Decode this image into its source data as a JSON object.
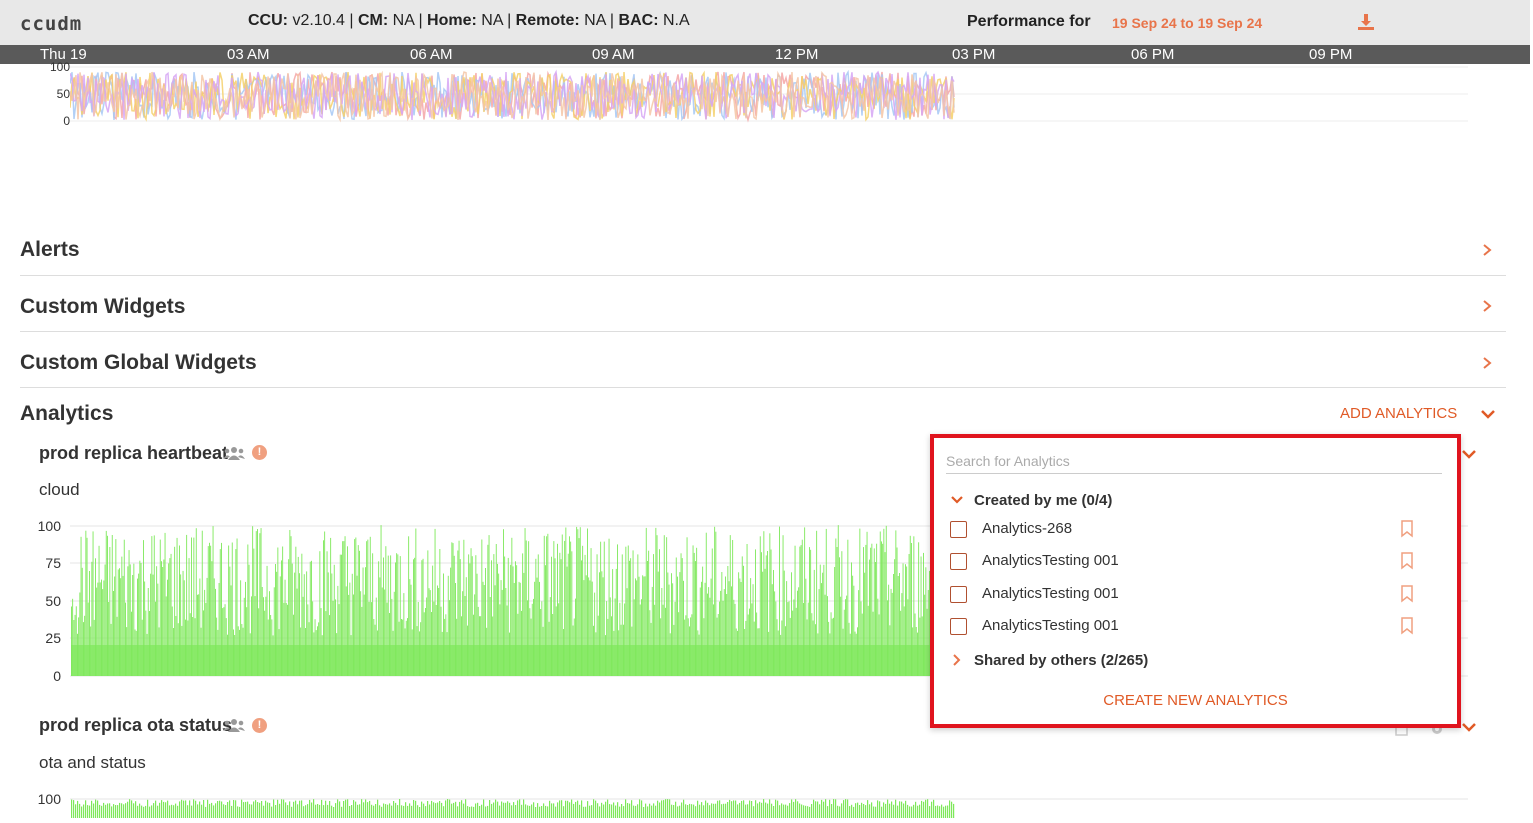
{
  "header": {
    "app_name": "ccudm",
    "ccu_label": "CCU:",
    "ccu_value": "v2.10.4",
    "cm_label": "CM:",
    "cm_value": "NA",
    "home_label": "Home:",
    "home_value": "NA",
    "remote_label": "Remote:",
    "remote_value": "NA",
    "bac_label": "BAC:",
    "bac_value": "N.A",
    "performance_label": "Performance for",
    "date_range": "19 Sep 24 to 19 Sep 24",
    "download_icon": "download-icon"
  },
  "timeline": {
    "ticks": [
      "Thu 19",
      "03 AM",
      "06 AM",
      "09 AM",
      "12 PM",
      "03 PM",
      "06 PM",
      "09 PM"
    ]
  },
  "mini_chart": {
    "y_ticks": [
      "100",
      "50",
      "0"
    ],
    "colors": [
      "#f4a6a6",
      "#a6c8f4",
      "#f4d06a",
      "#d6a6f4",
      "#f4c6a6"
    ]
  },
  "sections": [
    {
      "title": "Alerts"
    },
    {
      "title": "Custom Widgets"
    },
    {
      "title": "Custom Global Widgets"
    }
  ],
  "analytics": {
    "title": "Analytics",
    "add_label": "ADD ANALYTICS",
    "widgets": [
      {
        "title": "prod replica heartbeat",
        "subtitle": "cloud",
        "y_ticks": [
          "100",
          "75",
          "50",
          "25",
          "0"
        ],
        "bar_color": "#7ee85a"
      },
      {
        "title": "prod replica ota status",
        "subtitle": "ota and status",
        "y_ticks": [
          "100"
        ],
        "bar_color": "#7ee85a"
      }
    ]
  },
  "dropdown": {
    "search_placeholder": "Search for Analytics",
    "created_group": "Created by me (0/4)",
    "items": [
      {
        "label": "Analytics-268"
      },
      {
        "label": "AnalyticsTesting 001"
      },
      {
        "label": "AnalyticsTesting 001"
      },
      {
        "label": "AnalyticsTesting 001"
      }
    ],
    "shared_group": "Shared by others (2/265)",
    "create_label": "CREATE NEW ANALYTICS"
  },
  "colors": {
    "accent": "#e05a26",
    "highlight_border": "#e0141e"
  }
}
